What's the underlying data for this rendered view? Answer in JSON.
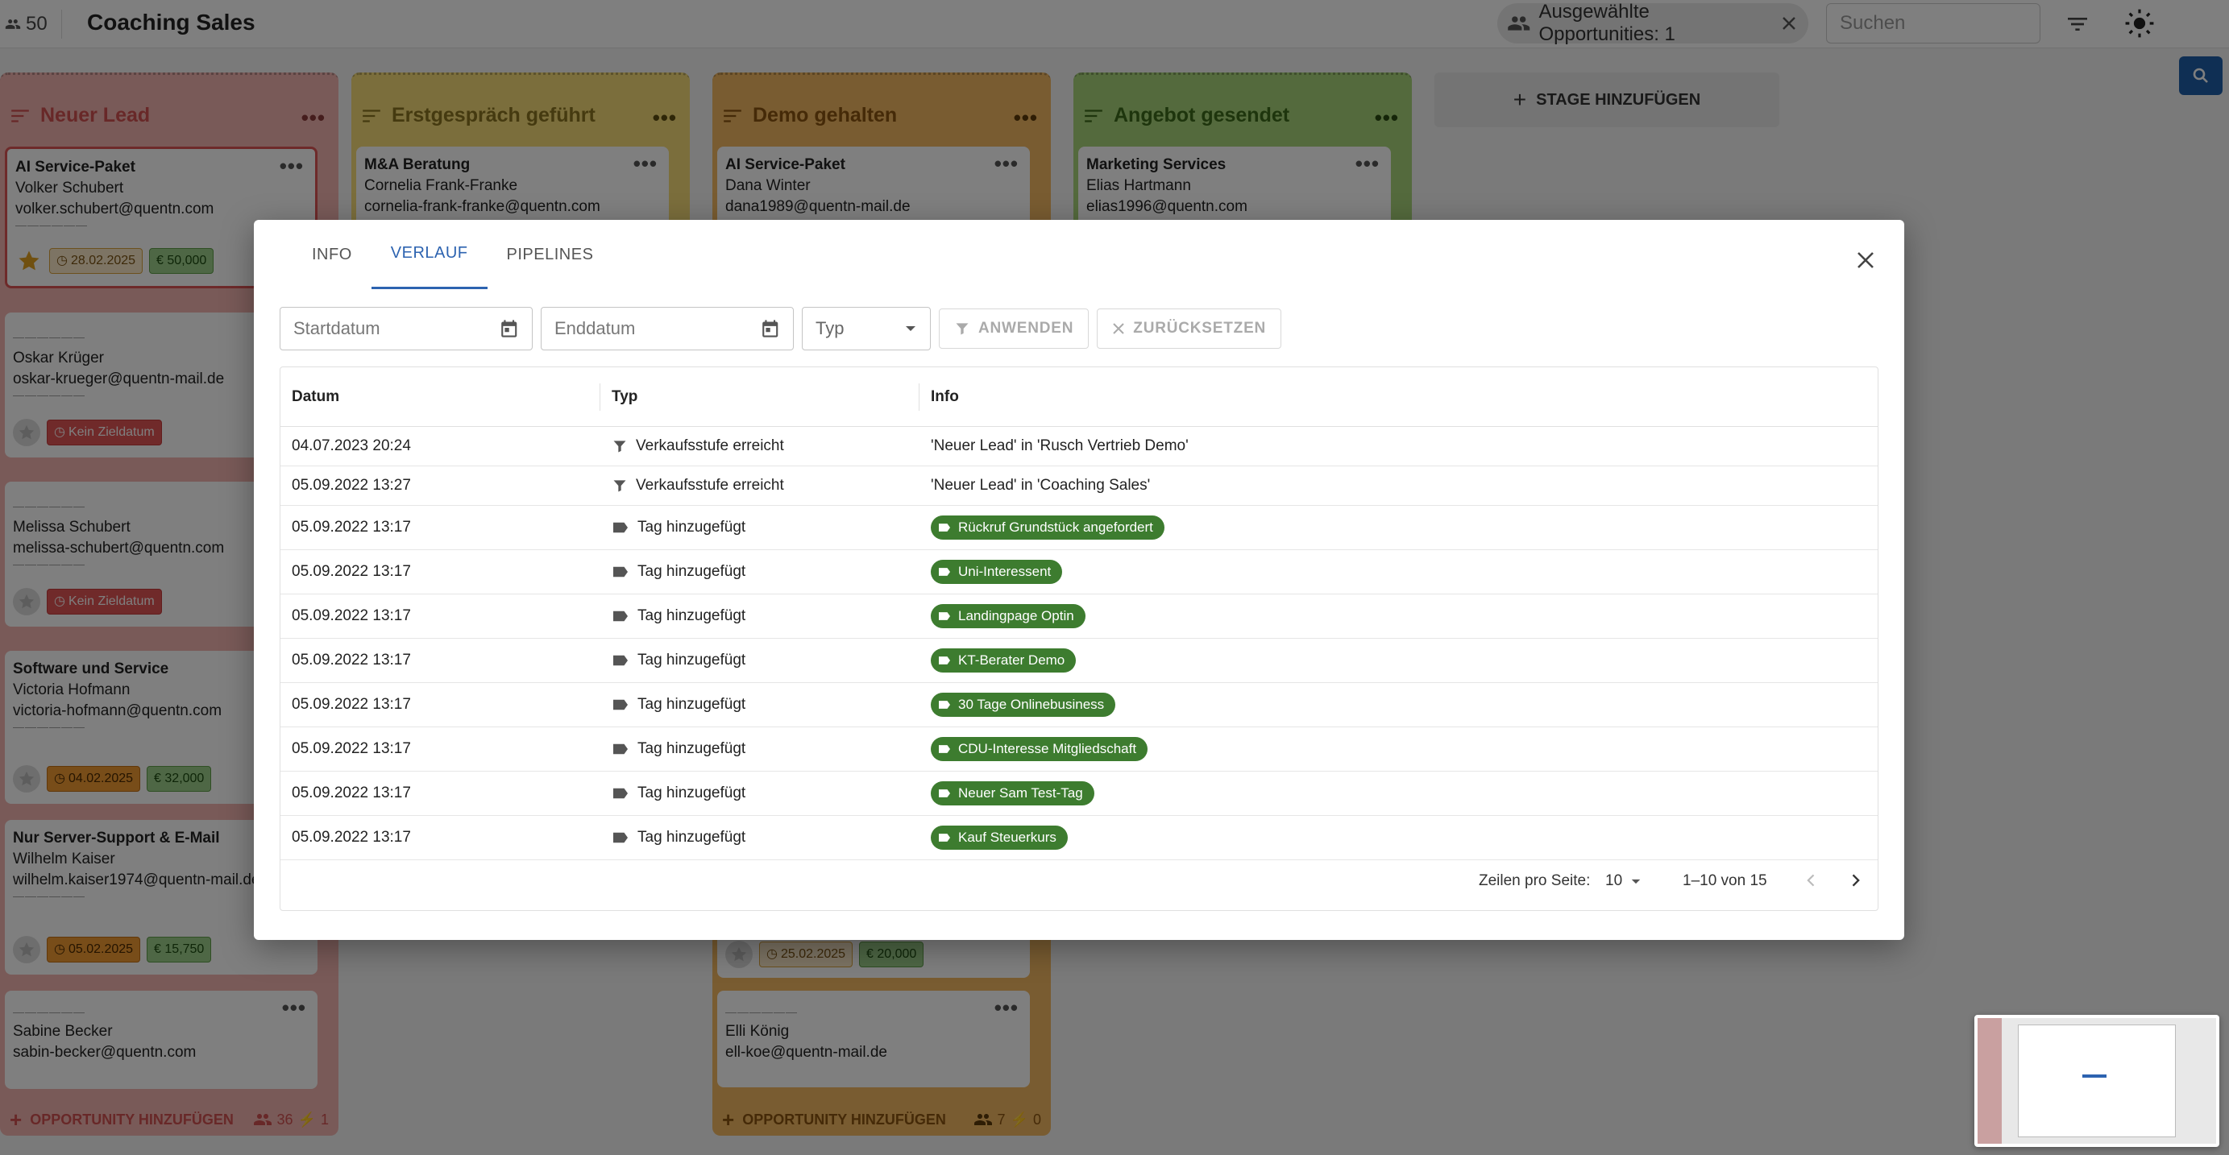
{
  "topbar": {
    "count": "50",
    "title": "Coaching Sales",
    "chip_label": "Ausgewählte Opportunities: 1",
    "search_placeholder": "Suchen"
  },
  "board": {
    "add_stage_label": "STAGE HINZUFÜGEN",
    "columns": [
      {
        "title": "Neuer Lead",
        "color": "#f2b5b0",
        "cards": [
          {
            "title": "AI Service-Paket",
            "name": "Volker Schubert",
            "email": "volker.schubert@quentn.com",
            "date": "28.02.2025",
            "amount": "€ 50,000"
          },
          {
            "title": "",
            "name": "Oskar Krüger",
            "email": "oskar-krueger@quentn-mail.de",
            "date": "Kein Zieldatum",
            "amount": ""
          },
          {
            "title": "",
            "name": "Melissa Schubert",
            "email": "melissa-schubert@quentn.com",
            "date": "Kein Zieldatum",
            "amount": ""
          },
          {
            "title": "Software und Service",
            "name": "Victoria Hofmann",
            "email": "victoria-hofmann@quentn.com",
            "date": "04.02.2025",
            "amount": "€ 32,000"
          },
          {
            "title": "Nur Server-Support & E-Mail",
            "name": "Wilhelm Kaiser",
            "email": "wilhelm.kaiser1974@quentn-mail.de",
            "date": "05.02.2025",
            "amount": "€ 15,750"
          },
          {
            "title": "",
            "name": "Sabine Becker",
            "email": "sabin-becker@quentn.com",
            "date": "",
            "amount": ""
          }
        ],
        "footer_add": "OPPORTUNITY HINZUFÜGEN",
        "footer_people": "36",
        "footer_flash": "1"
      },
      {
        "title": "Erstgespräch geführt",
        "color": "#f6dc78",
        "cards": [
          {
            "title": "M&A Beratung",
            "name": "Cornelia Frank-Franke",
            "email": "cornelia-frank-franke@quentn.com",
            "date": "",
            "amount": ""
          }
        ]
      },
      {
        "title": "Demo gehalten",
        "color": "#f3b862",
        "cards": [
          {
            "title": "AI Service-Paket",
            "name": "Dana Winter",
            "email": "dana1989@quentn-mail.de",
            "date": "",
            "amount": ""
          },
          {
            "title": "",
            "name": "",
            "email": "",
            "date": "25.02.2025",
            "amount": "€ 20,000"
          },
          {
            "title": "",
            "name": "Elli König",
            "email": "ell-koe@quentn-mail.de",
            "date": "",
            "amount": ""
          }
        ],
        "footer_add": "OPPORTUNITY HINZUFÜGEN",
        "footer_people": "7",
        "footer_flash": "0"
      },
      {
        "title": "Angebot gesendet",
        "color": "#a8d57a",
        "cards": [
          {
            "title": "Marketing Services",
            "name": "Elias Hartmann",
            "email": "elias1996@quentn.com",
            "date": "",
            "amount": ""
          }
        ]
      }
    ]
  },
  "dialog": {
    "tabs": [
      "INFO",
      "VERLAUF",
      "PIPELINES"
    ],
    "active_tab": "VERLAUF",
    "filters": {
      "start_placeholder": "Startdatum",
      "end_placeholder": "Enddatum",
      "type_placeholder": "Typ",
      "apply_label": "ANWENDEN",
      "reset_label": "ZURÜCKSETZEN"
    },
    "table": {
      "headers": [
        "Datum",
        "Typ",
        "Info"
      ],
      "rows": [
        {
          "date": "04.07.2023 20:24",
          "type": "Verkaufsstufe erreicht",
          "icon": "funnel-icon",
          "info": "'Neuer Lead' in 'Rusch Vertrieb Demo'",
          "is_tag": false
        },
        {
          "date": "05.09.2022 13:27",
          "type": "Verkaufsstufe erreicht",
          "icon": "funnel-icon",
          "info": "'Neuer Lead' in 'Coaching Sales'",
          "is_tag": false
        },
        {
          "date": "05.09.2022 13:17",
          "type": "Tag hinzugefügt",
          "icon": "tag-icon",
          "info": "Rückruf Grundstück angefordert",
          "is_tag": true
        },
        {
          "date": "05.09.2022 13:17",
          "type": "Tag hinzugefügt",
          "icon": "tag-icon",
          "info": "Uni-Interessent",
          "is_tag": true
        },
        {
          "date": "05.09.2022 13:17",
          "type": "Tag hinzugefügt",
          "icon": "tag-icon",
          "info": "Landingpage Optin",
          "is_tag": true
        },
        {
          "date": "05.09.2022 13:17",
          "type": "Tag hinzugefügt",
          "icon": "tag-icon",
          "info": "KT-Berater Demo",
          "is_tag": true
        },
        {
          "date": "05.09.2022 13:17",
          "type": "Tag hinzugefügt",
          "icon": "tag-icon",
          "info": "30 Tage Onlinebusiness",
          "is_tag": true
        },
        {
          "date": "05.09.2022 13:17",
          "type": "Tag hinzugefügt",
          "icon": "tag-icon",
          "info": "CDU-Interesse Mitgliedschaft",
          "is_tag": true
        },
        {
          "date": "05.09.2022 13:17",
          "type": "Tag hinzugefügt",
          "icon": "tag-icon",
          "info": "Neuer Sam Test-Tag",
          "is_tag": true
        },
        {
          "date": "05.09.2022 13:17",
          "type": "Tag hinzugefügt",
          "icon": "tag-icon",
          "info": "Kauf Steuerkurs",
          "is_tag": true
        }
      ]
    },
    "pagination": {
      "rows_label": "Zeilen pro Seite:",
      "rows_value": "10",
      "range": "1–10 von 15"
    }
  },
  "colors": {
    "accent": "#2d63b0",
    "tag_green": "#3d7c2f"
  }
}
